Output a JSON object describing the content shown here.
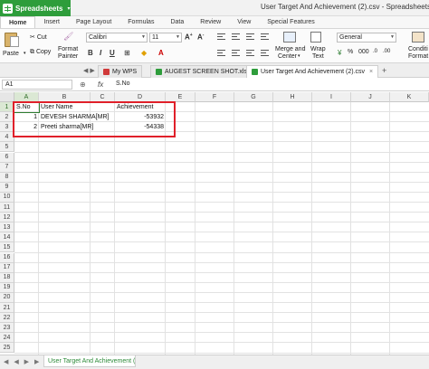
{
  "app": {
    "name": "Spreadsheets",
    "window_title": "User Target And Achievement (2).csv - Spreadsheets"
  },
  "menu": [
    "Home",
    "Insert",
    "Page Layout",
    "Formulas",
    "Data",
    "Review",
    "View",
    "Special Features"
  ],
  "ribbon": {
    "paste": "Paste",
    "cut": "Cut",
    "copy": "Copy",
    "format_painter_1": "Format",
    "format_painter_2": "Painter",
    "font": "Calibri",
    "size": "11",
    "merge_1": "Merge and",
    "merge_2": "Center",
    "wrap_1": "Wrap",
    "wrap_2": "Text",
    "number_format": "General",
    "cond_1": "Conditi",
    "cond_2": "Format"
  },
  "doc_tabs": [
    {
      "label": "My WPS"
    },
    {
      "label": "AUGEST SCREEN SHOT.xlsx"
    },
    {
      "label": "User Target And Achievement (2).csv"
    }
  ],
  "formula_bar": {
    "name_box": "A1",
    "fx": "fx",
    "content": "S.No"
  },
  "columns": [
    "A",
    "B",
    "C",
    "D",
    "E",
    "F",
    "G",
    "H",
    "I",
    "J",
    "K"
  ],
  "rows": [
    "1",
    "2",
    "3",
    "4",
    "5",
    "6",
    "7",
    "8",
    "9",
    "10",
    "11",
    "12",
    "13",
    "14",
    "15",
    "16",
    "17",
    "18",
    "19",
    "20",
    "21",
    "22",
    "23",
    "24",
    "25"
  ],
  "cells": {
    "a1": "S.No",
    "b1": "User Name",
    "d1": "Achievement",
    "a2": "1",
    "b2": "DEVESH  SHARMA[MR]",
    "d2": "-53932",
    "a3": "2",
    "b3": "Preeti  sharma[MR]",
    "d3": "-54338"
  },
  "sheet_tab": "User Target And Achievement (2)",
  "colors": {
    "brand": "#2e9d3b",
    "highlight_box": "#e0202a"
  }
}
